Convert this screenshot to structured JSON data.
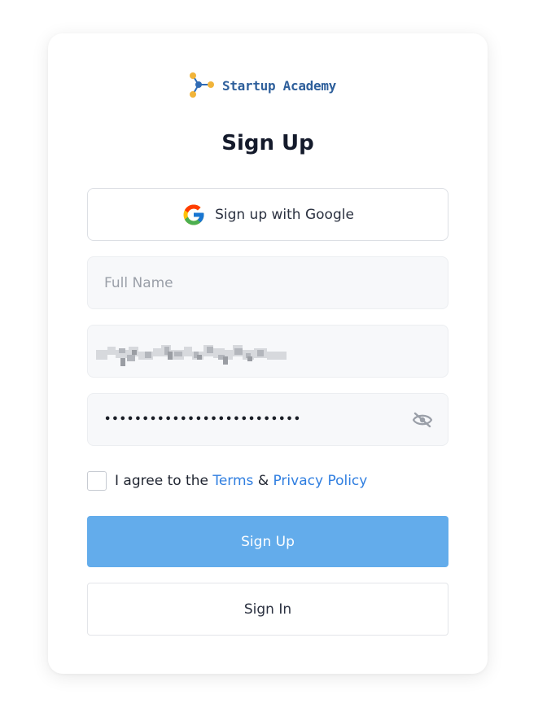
{
  "brand": {
    "name": "Startup Academy",
    "colors": {
      "text": "#2e5f9b",
      "node_yellow": "#f1b43a",
      "node_blue": "#2f6bb5"
    },
    "icon": "startup-academy-logo-icon"
  },
  "form": {
    "title": "Sign Up",
    "google": {
      "label": "Sign up with Google",
      "icon": "google-icon"
    },
    "full_name": {
      "placeholder": "Full Name",
      "value": ""
    },
    "email": {
      "value_obscured": true
    },
    "password": {
      "value": "••••••••••••••••••••••••••",
      "toggle_icon": "eye-off-icon"
    },
    "agreement": {
      "checked": false,
      "prefix": "I agree to the",
      "terms": "Terms",
      "separator": "&",
      "privacy": "Privacy Policy"
    },
    "submit_label": "Sign Up",
    "signin_label": "Sign In"
  },
  "colors": {
    "primary": "#63aceb",
    "link": "#2f7ee0",
    "field_bg": "#f7f8fa",
    "text": "#141a2b"
  }
}
